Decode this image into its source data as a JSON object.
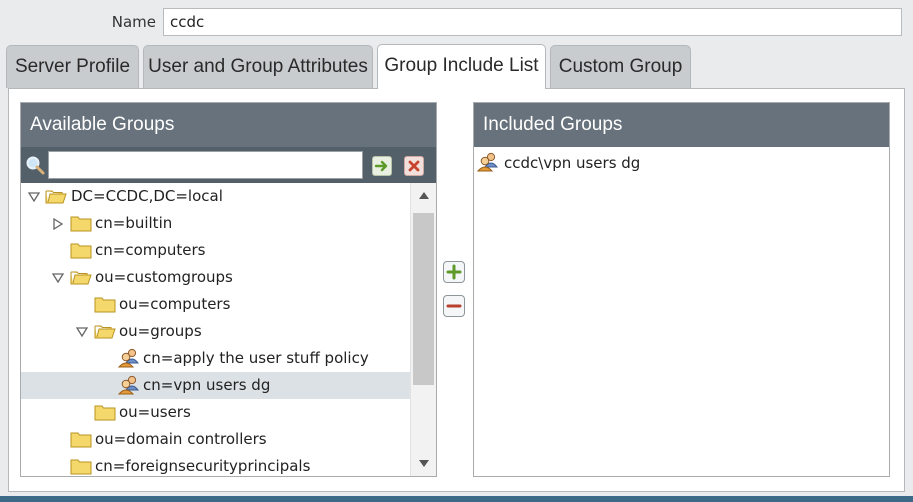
{
  "form": {
    "name_label": "Name",
    "name_value": "ccdc"
  },
  "tabs": [
    {
      "label": "Server Profile",
      "active": false
    },
    {
      "label": "User and Group Attributes",
      "active": false
    },
    {
      "label": "Group Include List",
      "active": true
    },
    {
      "label": "Custom Group",
      "active": false
    }
  ],
  "available_groups": {
    "title": "Available Groups",
    "search_value": "",
    "tree": [
      {
        "label": "DC=CCDC,DC=local",
        "type": "folder",
        "expanded": true
      },
      {
        "label": "cn=builtin",
        "type": "folder",
        "expanded": false
      },
      {
        "label": "cn=computers",
        "type": "folder"
      },
      {
        "label": "ou=customgroups",
        "type": "folder",
        "expanded": true
      },
      {
        "label": "ou=computers",
        "type": "folder"
      },
      {
        "label": "ou=groups",
        "type": "folder",
        "expanded": true
      },
      {
        "label": "cn=apply the user stuff policy",
        "type": "group"
      },
      {
        "label": "cn=vpn users dg",
        "type": "group",
        "selected": true
      },
      {
        "label": "ou=users",
        "type": "folder"
      },
      {
        "label": "ou=domain controllers",
        "type": "folder"
      },
      {
        "label": "cn=foreignsecurityprincipals",
        "type": "folder"
      }
    ]
  },
  "included_groups": {
    "title": "Included Groups",
    "items": [
      "ccdc\\vpn users dg"
    ]
  },
  "icons": {
    "search": "search-icon",
    "go": "arrow-right-icon",
    "clear": "close-icon",
    "add": "plus-icon",
    "remove": "minus-icon",
    "folder": "folder-icon",
    "group": "user-group-icon"
  },
  "colors": {
    "panel_header": "#67727c",
    "search_bar": "#546069",
    "selected_row": "#dce1e5",
    "folder": "#f5d86b",
    "accent_blue": "#3e6a8a"
  }
}
